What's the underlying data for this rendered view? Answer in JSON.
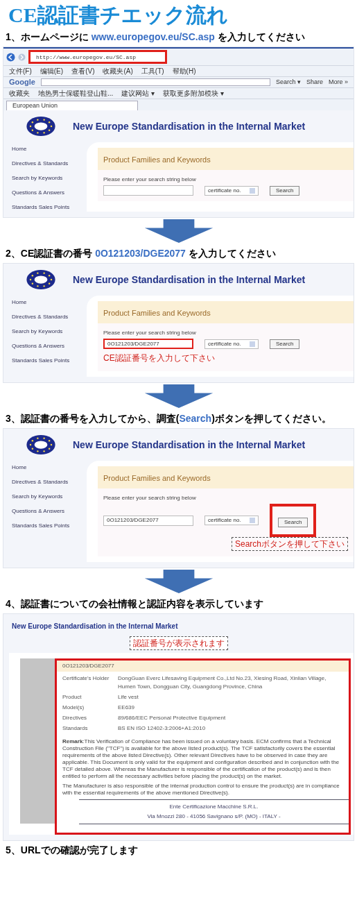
{
  "title": "CE認証書チエック流れ",
  "steps": [
    {
      "label": "1、ホームページに ",
      "highlight": "www.europegov.eu/SC.asp",
      "after": " を入力してください",
      "screen": {
        "kind": "search",
        "url_marked": true,
        "query_marked": false,
        "button_marked": false,
        "browser": {
          "url": "http://www.europegov.eu/SC.asp",
          "menu": [
            "文件(F)",
            "编辑(E)",
            "查看(V)",
            "收藏夹(A)",
            "工具(T)",
            "帮助(H)"
          ],
          "toolbar": {
            "brand": "Google",
            "buttons": [
              "Search ▾",
              "Share",
              "More »"
            ]
          },
          "favorites": [
            "收藏夹",
            "地热男士保暖鞋登山鞋...",
            "建议网站 ▾",
            "获取更多附加模块 ▾"
          ],
          "tab": "European Union"
        },
        "site_title": "New Europe Standardisation in the Internal Market",
        "nav": [
          "Home",
          "Directives & Standards",
          "Search by Keywords",
          "Questions & Answers",
          "Standards Sales Points"
        ],
        "panel_title": "Product Families and Keywords",
        "prompt": "Please enter your search string below",
        "select": "certificate no.",
        "button": "Search"
      }
    },
    {
      "label": "2、CE認証書の番号 ",
      "highlight": "0O121203/DGE2077",
      "after": " を入力してください",
      "screen": {
        "kind": "search",
        "query_marked": true,
        "button_marked": false,
        "site_title": "New Europe Standardisation in the Internal Market",
        "nav": [
          "Home",
          "Directives & Standards",
          "Search by Keywords",
          "Questions & Answers",
          "Standards Sales Points"
        ],
        "panel_title": "Product Families and Keywords",
        "prompt": "Please enter your search string below",
        "query": "0O121203/DGE2077",
        "note": "CE認証番号を入力して下さい",
        "select": "certificate no.",
        "button": "Search"
      }
    },
    {
      "label": "3、認証書の番号を入力してから、調査(",
      "highlight": "Search",
      "after": ")ボタンを押してください。",
      "screen": {
        "kind": "search",
        "query_marked": false,
        "button_marked": true,
        "site_title": "New Europe Standardisation in the Internal Market",
        "nav": [
          "Home",
          "Directives & Standards",
          "Search by Keywords",
          "Questions & Answers",
          "Standards Sales Points"
        ],
        "panel_title": "Product Families and Keywords",
        "prompt": "Please enter your search string below",
        "query": "0O121203/DGE2077",
        "note": "Searchボタンを押して下さい",
        "select": "certificate no.",
        "button": "Search"
      }
    },
    {
      "label": "4、認証書についての会社情報と認証内容を表示しています",
      "screen": {
        "kind": "result",
        "site_title": "New Europe Standardisation in the Internal Market",
        "note": "認証番号が表示されます",
        "number": "0O121203/DGE2077",
        "rows": [
          {
            "label": "Certificate's Holder",
            "value": "DongGuan Everc Lifesaving Equipment Co.,Ltd No.23, Xiesing Road, Xinlian Village, Humen Town, Dongguan City, Guangdong Province, China"
          },
          {
            "label": "Product",
            "value": "Life vest"
          },
          {
            "label": "Model(s)",
            "value": "EE639"
          },
          {
            "label": "Directives",
            "value": "89/686/EEC Personal Protective Equipment"
          },
          {
            "label": "Standards",
            "value": "BS EN ISO 12402-3:2006+A1:2010"
          }
        ],
        "remark": "**Remark**:This Verification of Compliance has been issued on a voluntary basis. ECM confirms that a Technical Construction File (\"TCF\") is available for the above listed product(s). The TCF satisfactorily covers the essential requirements of the above listed Directive(s). Other relevant Directives have to be observed in case they are applicable. This Document is only valid for the equipment and configuration described and in conjunction with the TCF detailed above. Whereas the Manufacturer is responsible of the certification of the product(s) and is then entitled to perform all the necessary activities before placing the product(s) on the market.",
        "remark_2": "The Manufacturer is also responsible of the internal production control to ensure the product(s) are in compliance with the essential requirements of the above mentioned Directive(s).",
        "issuer": "Ente Certificazione Macchine S.R.L.",
        "address": "Via Mnozzi 280 - 41056 Savignano s/P. (MO) - ITALY -"
      }
    },
    {
      "label": "5、URLでの確認が完了します"
    }
  ]
}
